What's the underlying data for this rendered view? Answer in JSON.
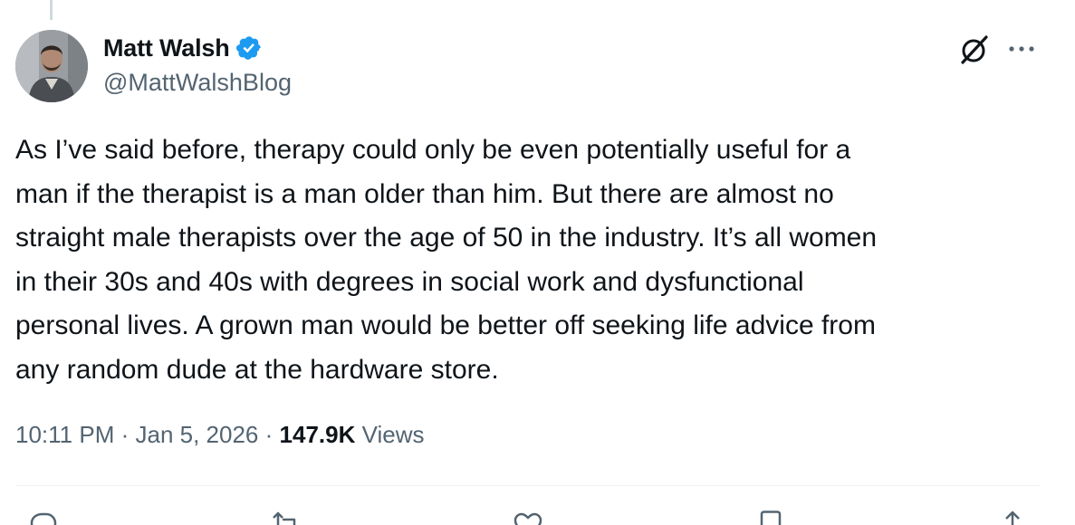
{
  "author": {
    "display_name": "Matt Walsh",
    "handle": "@MattWalshBlog",
    "verified": true
  },
  "tweet": {
    "text": "As I’ve said before, therapy could only be even potentially useful for a\nman if the therapist is a man older than him. But there are almost no\nstraight male therapists over the age of 50 in the industry. It’s all women\nin their 30s and 40s with degrees in social work and dysfunctional\npersonal lives. A grown man would be better off seeking life advice from\nany random dude at the hardware store."
  },
  "meta": {
    "time": "10:11 PM",
    "separator": "·",
    "date": "Jan 5, 2026",
    "views_count": "147.9K",
    "views_label": "Views"
  },
  "colors": {
    "verified_blue": "#1d9bf0",
    "secondary_text": "#536471",
    "primary_text": "#0f1419"
  },
  "icons": {
    "verified": "verified-badge-icon",
    "grok": "grok-icon",
    "more": "more-options-icon",
    "reply": "reply-icon",
    "repost": "repost-icon",
    "like": "like-icon",
    "bookmark": "bookmark-icon",
    "share": "share-icon"
  }
}
